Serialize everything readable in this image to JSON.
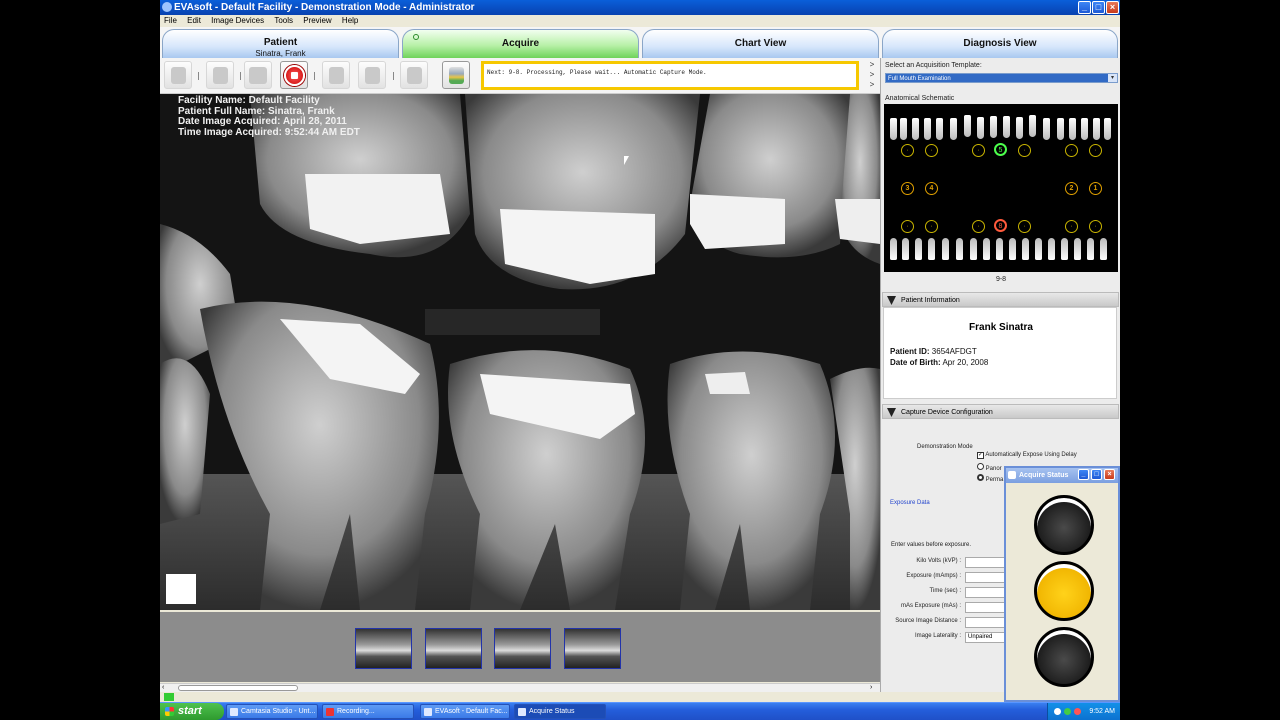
{
  "window": {
    "title": "EVAsoft - Default Facility - Demonstration Mode - Administrator",
    "menu": [
      "File",
      "Edit",
      "Image Devices",
      "Tools",
      "Preview",
      "Help"
    ]
  },
  "tabs": [
    {
      "label": "Patient",
      "sub": "Sinatra, Frank"
    },
    {
      "label": "Acquire",
      "sub": ""
    },
    {
      "label": "Chart View",
      "sub": ""
    },
    {
      "label": "Diagnosis View",
      "sub": ""
    }
  ],
  "toolbar": {
    "status_message": "Next: 9-8.  Processing, Please wait...  Automatic Capture Mode.",
    "arrows": [
      ">",
      ">",
      ">"
    ]
  },
  "image_info": {
    "facility": "Facility Name: Default Facility",
    "patient": "Patient Full Name: Sinatra, Frank",
    "date": "Date Image Acquired: April 28, 2011",
    "time": "Time Image Acquired: 9:52:44 AM EDT"
  },
  "thumbnails": [
    {
      "name": "thumb-1"
    },
    {
      "name": "thumb-2"
    },
    {
      "name": "thumb-3"
    },
    {
      "name": "thumb-4"
    }
  ],
  "right_panel": {
    "template_label": "Select an Acquisition Template:",
    "template_value": "Full Mouth Examination",
    "schematic_label": "Anatomical Schematic",
    "schematic_position": "9-8",
    "schematic_numbers": {
      "upper": [
        "3",
        "4",
        "2",
        "1"
      ],
      "lower_green": "5",
      "lower_red": "8"
    },
    "patient_info_header": "Patient Information",
    "patient_name": "Frank Sinatra",
    "patient_id_label": "Patient ID:",
    "patient_id": "3654AFDGT",
    "dob_label": "Date of Birth:",
    "dob": "Apr 20, 2008",
    "capture_header": "Capture Device Configuration",
    "demo_mode": "Demonstration Mode",
    "auto_expose": "Automatically Expose Using Delay",
    "opt_pano": "Panor",
    "opt_perm": "Perma",
    "exposure_data": "Exposure Data",
    "enter_values": "Enter values before exposure.",
    "fields": [
      {
        "label": "Kilo Volts (kVP) :",
        "value": ""
      },
      {
        "label": "Exposure (mAmps) :",
        "value": ""
      },
      {
        "label": "Time (sec) :",
        "value": ""
      },
      {
        "label": "mAs Exposure (mAs) :",
        "value": ""
      },
      {
        "label": "Source Image Distance :",
        "value": ""
      },
      {
        "label": "Image Laterality :",
        "value": "Unpaired"
      }
    ]
  },
  "acquire_status": {
    "title": "Acquire Status",
    "lights": [
      "off",
      "on",
      "off"
    ]
  },
  "taskbar": {
    "start": "start",
    "tasks": [
      "Camtasia Studio - Unt...",
      "Recording...",
      "EVAsoft - Default Fac...",
      "Acquire Status"
    ],
    "time": "9:52 AM"
  }
}
